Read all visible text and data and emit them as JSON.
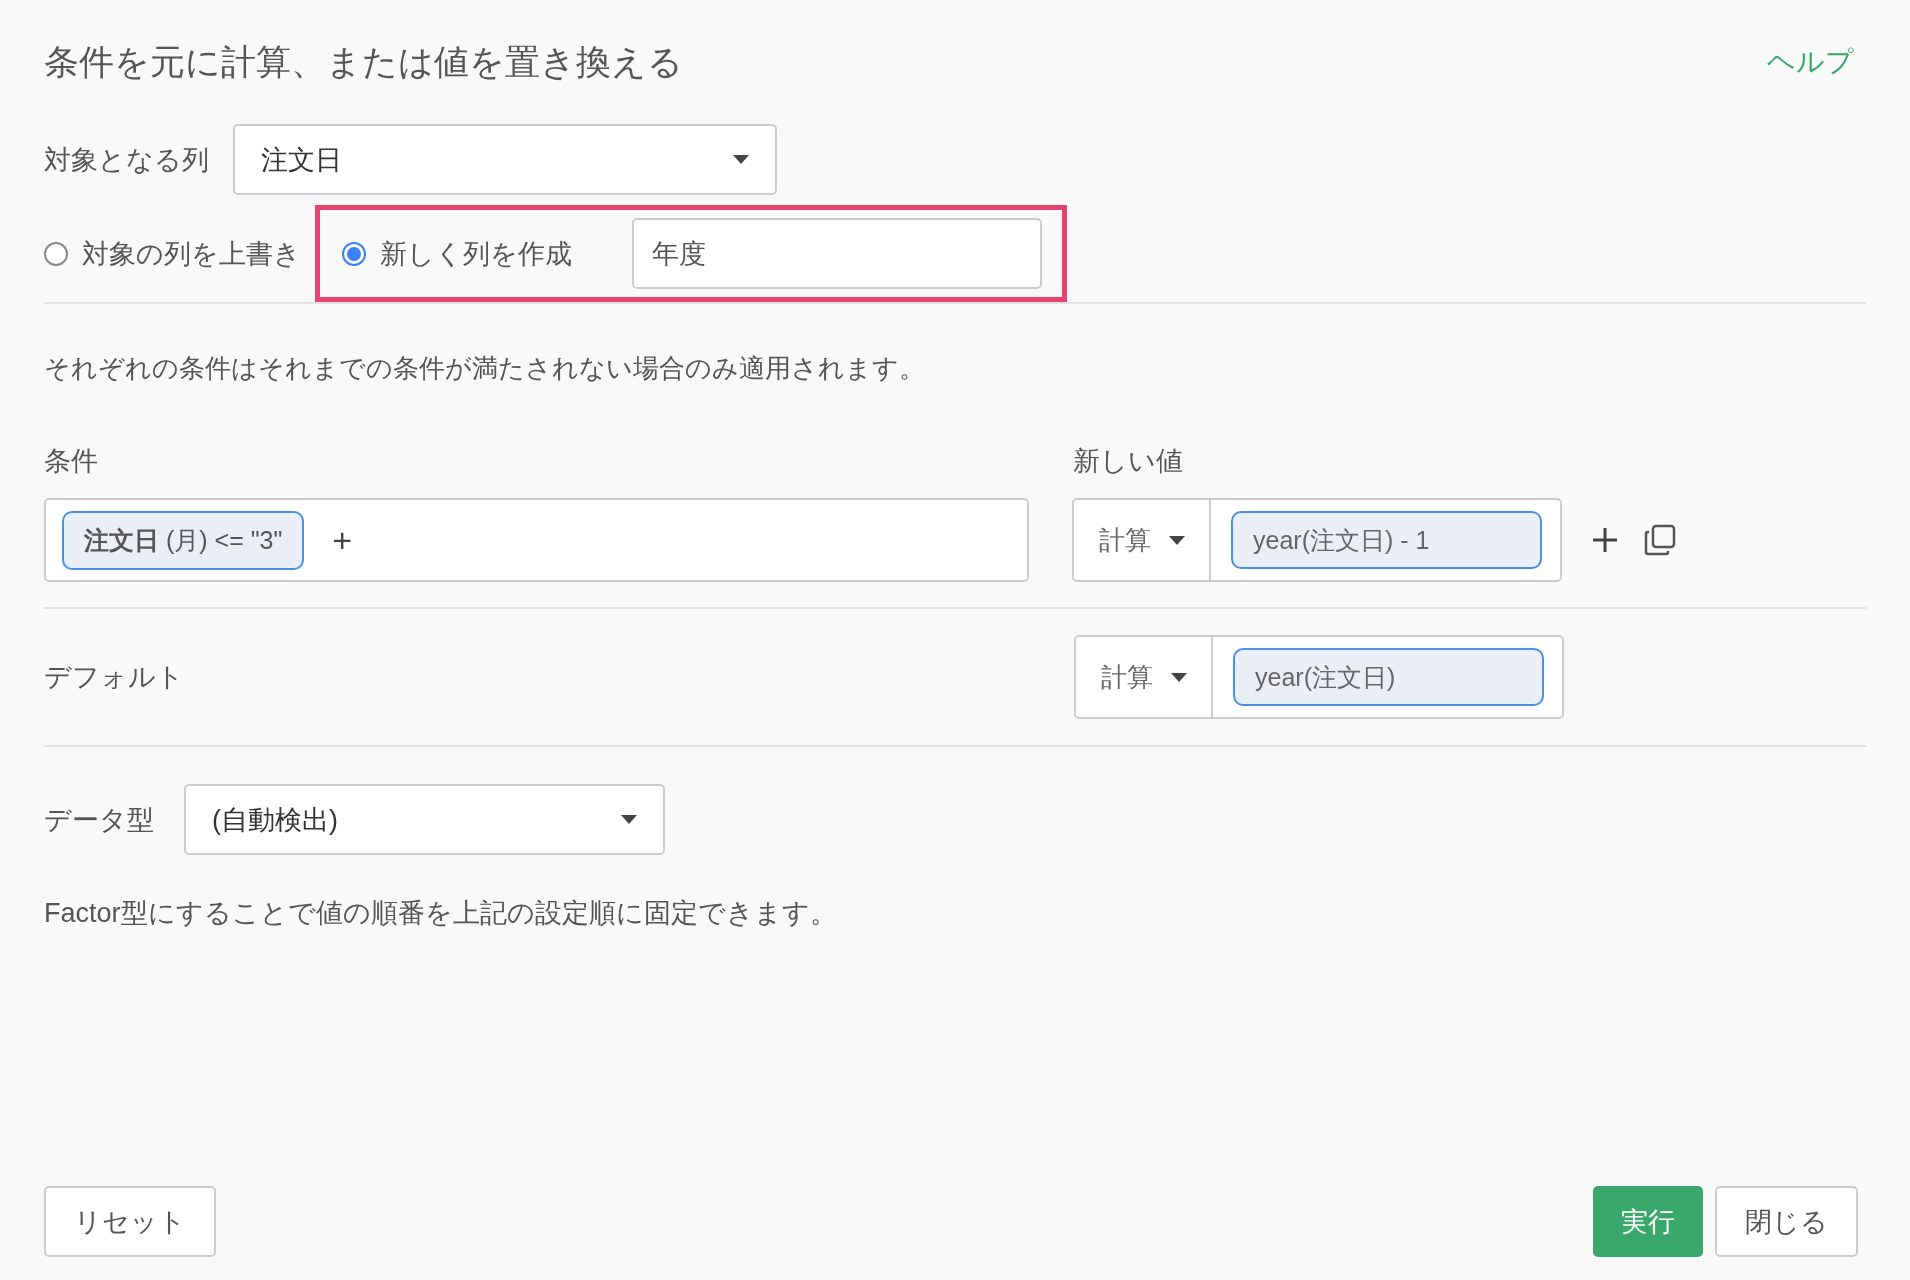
{
  "title": "条件を元に計算、または値を置き換える",
  "help_link": "ヘルプ",
  "target_column": {
    "label": "対象となる列",
    "value": "注文日"
  },
  "output_mode": {
    "options": [
      {
        "label": "対象の列を上書き",
        "selected": false
      },
      {
        "label": "新しく列を作成",
        "selected": true
      }
    ],
    "new_column_name": "年度",
    "highlighted": true
  },
  "note": "それぞれの条件はそれまでの条件が満たされない場合のみ適用されます。",
  "condition_header": "条件",
  "new_value_header": "新しい値",
  "rules": [
    {
      "condition": "**注文日** (月) <= \"3\"",
      "add_condition": "+",
      "type": "計算",
      "value": "year(注文日) - 1"
    }
  ],
  "default": {
    "label": "デフォルト",
    "type": "計算",
    "value": "year(注文日)"
  },
  "data_type": {
    "label": "データ型",
    "value": "(自動検出)"
  },
  "factor_note": "Factor型にすることで値の順番を上記の設定順に固定できます。",
  "buttons": {
    "reset": "リセット",
    "run": "実行",
    "close": "閉じる"
  }
}
